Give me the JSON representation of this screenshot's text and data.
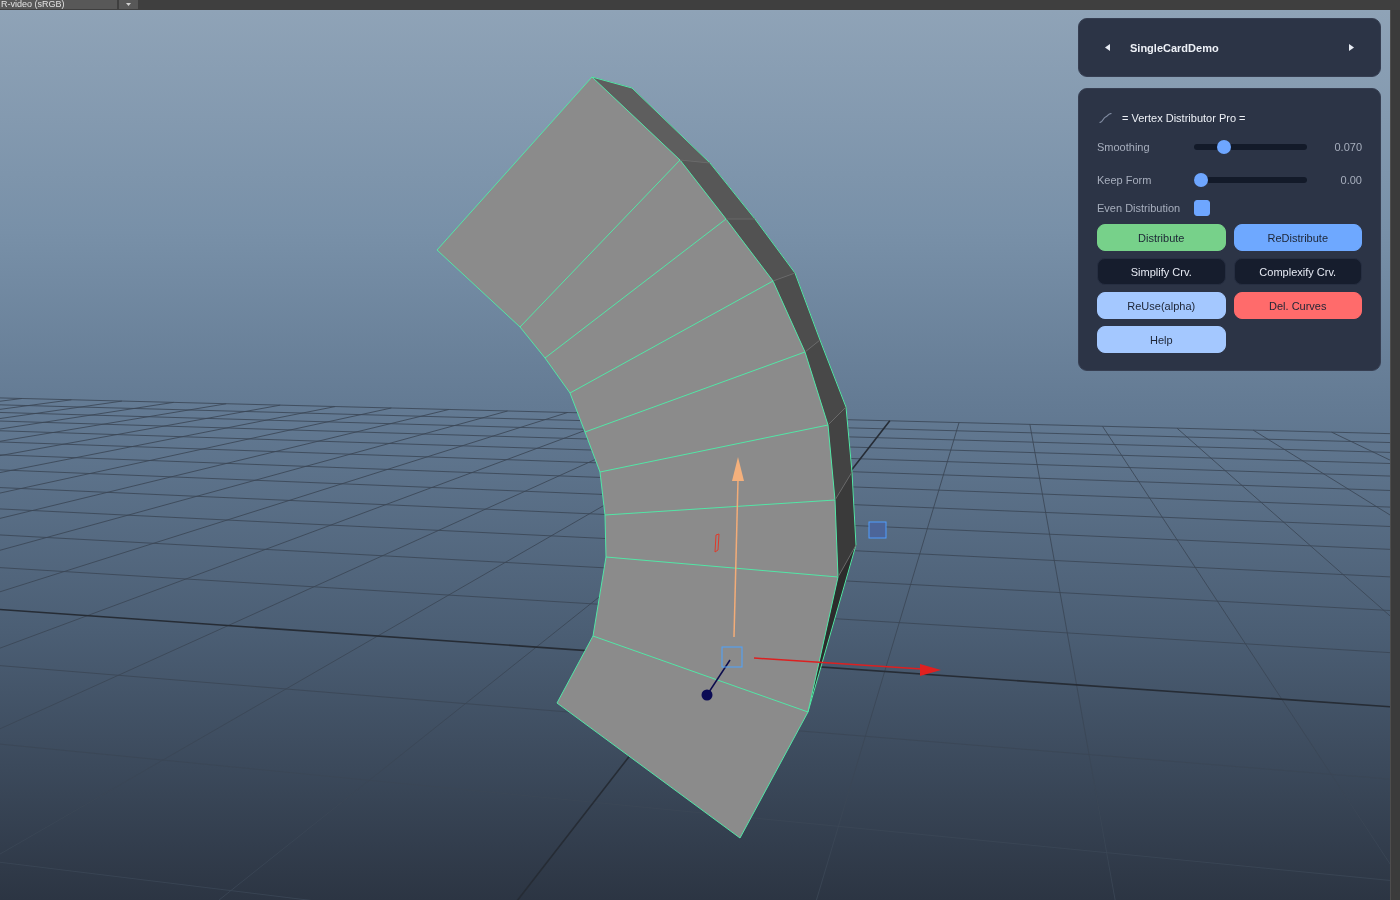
{
  "toolbar": {
    "color_space": "R-video (sRGB)"
  },
  "header_card": {
    "title": "SingleCardDemo"
  },
  "tool_card": {
    "title": "= Vertex Distributor Pro =",
    "sliders": [
      {
        "label": "Smoothing",
        "level": 0.23,
        "reading": "0.070"
      },
      {
        "label": "Keep Form",
        "level": 0,
        "reading": "0.00"
      }
    ],
    "checkbox": {
      "label": "Even Distribution",
      "checked": true
    },
    "buttons": [
      {
        "label": "Distribute",
        "kind": "success"
      },
      {
        "label": "ReDistribute",
        "kind": "accent"
      },
      {
        "label": "Simplify Crv.",
        "kind": "dark"
      },
      {
        "label": "Complexify Crv.",
        "kind": "dark"
      },
      {
        "label": "ReUse(alpha)",
        "kind": "soft"
      },
      {
        "label": "Del. Curves",
        "kind": "danger"
      },
      {
        "label": "Help",
        "kind": "soft"
      }
    ]
  }
}
